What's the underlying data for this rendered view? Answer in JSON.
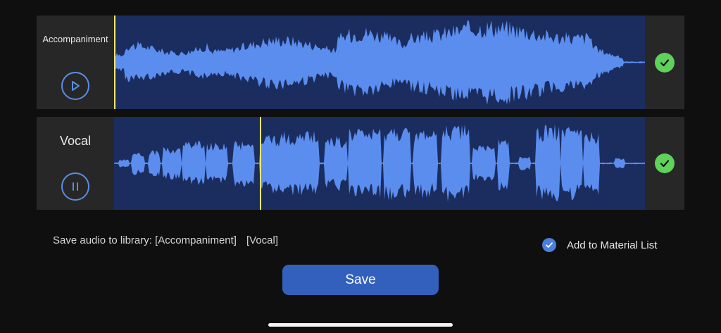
{
  "tracks": [
    {
      "label": "Accompaniment",
      "control_state": "play",
      "control_icon": "play-icon",
      "selected": true,
      "playhead_progress": 0.0
    },
    {
      "label": "Vocal",
      "control_state": "pause",
      "control_icon": "pause-icon",
      "selected": true,
      "playhead_progress": 0.275
    }
  ],
  "save_library": {
    "prefix": "Save audio to library:",
    "option_1": "[Accompaniment]",
    "option_2": "[Vocal]"
  },
  "material_list": {
    "label": "Add to Material List",
    "checked": true
  },
  "save_button": {
    "label": "Save"
  },
  "colors": {
    "background": "#0f0f0f",
    "track_panel": "#272727",
    "waveform_bg": "#1a2d5e",
    "waveform": "#5b8def",
    "playhead": "#f2e86a",
    "check_green": "#5ed25b",
    "accent_blue": "#3460bd"
  }
}
